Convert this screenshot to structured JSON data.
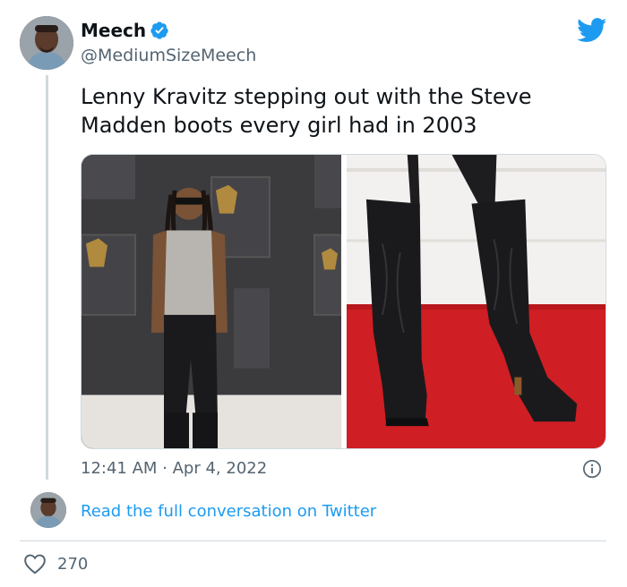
{
  "author": {
    "name": "Meech",
    "handle": "@MediumSizeMeech",
    "verified": true,
    "avatar_icon": "avatar-photo"
  },
  "tweet": {
    "text": "Lenny Kravitz stepping out with the Steve\nMadden boots every girl had in 2003",
    "timestamp": "12:41 AM · Apr 4, 2022",
    "media": [
      {
        "icon": "photo-man-in-mesh-top-and-boots"
      },
      {
        "icon": "photo-closeup-black-knee-boots-on-red-carpet"
      }
    ]
  },
  "actions": {
    "read_conversation": "Read the full conversation on Twitter",
    "like_count": "270"
  },
  "colors": {
    "link": "#1d9bf0",
    "secondary_text": "#536471",
    "border": "#cfd9de",
    "verified_badge": "#1d9bf0",
    "twitter_brand": "#1d9bf0"
  }
}
